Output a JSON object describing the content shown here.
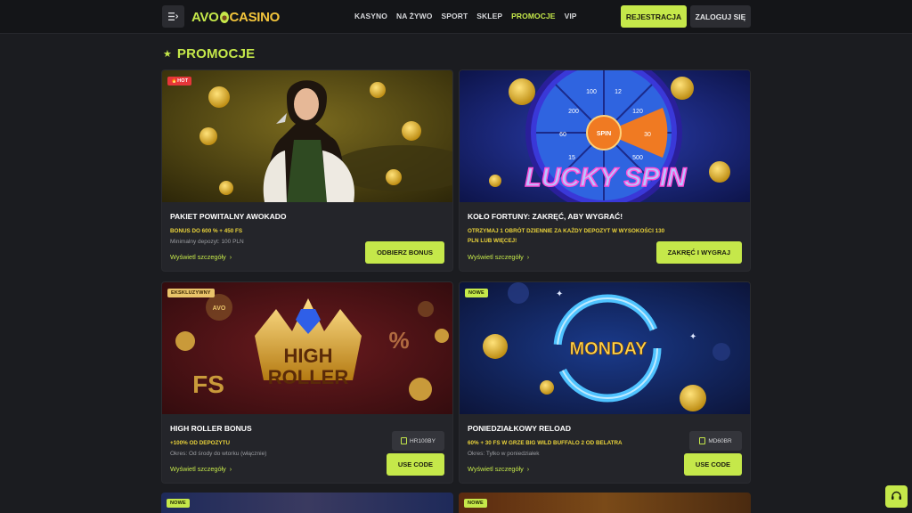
{
  "header": {
    "logo_left": "AVO",
    "logo_right": "CASINO",
    "nav": [
      "KASYNO",
      "NA ŻYWO",
      "SPORT",
      "SKLEP",
      "PROMOCJE",
      "VIP"
    ],
    "active_nav": "PROMOCJE",
    "register_label": "REJESTRACJA",
    "login_label": "ZALOGUJ SIĘ"
  },
  "page": {
    "title": "PROMOCJE"
  },
  "cards": [
    {
      "badge": "HOT",
      "title": "PAKIET POWITALNY AWOKADO",
      "subtitle": "BONUS DO 600 % + 450 FS",
      "description": "Minimalny depozyt: 100 PLN",
      "details": "Wyświetl szczegóły",
      "cta": "ODBIERZ BONUS"
    },
    {
      "badge": "",
      "title": "KOŁO FORTUNY: ZAKRĘĆ, ABY WYGRAĆ!",
      "subtitle": "OTRZYMAJ 1 OBRÓT DZIENNIE ZA KAŻDY DEPOZYT W WYSOKOŚCI 130 PLN LUB WIĘCEJ!",
      "description": "",
      "details": "Wyświetl szczegóły",
      "cta": "ZAKRĘĆ I WYGRAJ",
      "image_text": "LUCKY SPIN",
      "wheel_labels": [
        "SPIN",
        "120",
        "30",
        "500",
        "15",
        "60",
        "200",
        "100",
        "12"
      ]
    },
    {
      "badge": "EKSKLUZYWNY",
      "title": "HIGH ROLLER BONUS",
      "subtitle": "+100% OD DEPOZYTU",
      "description": "Okres: Od środy do wtorku (włącznie)",
      "details": "Wyświetl szczegóły",
      "code": "HR100BY",
      "cta": "USE CODE",
      "image_text": [
        "HIGH",
        "ROLLER"
      ],
      "image_extras": [
        "FS",
        "%",
        "AVO"
      ]
    },
    {
      "badge": "NOWE",
      "title": "PONIEDZIAŁKOWY RELOAD",
      "subtitle": "60% + 30 FS W GRZE BIG WILD BUFFALO 2 OD BELATRA",
      "description": "Okres: Tylko w poniedziałek",
      "details": "Wyświetl szczegóły",
      "code": "MD60BR",
      "cta": "USE CODE",
      "image_text": "MONDAY"
    }
  ],
  "bottom_badges": [
    "NOWE",
    "NOWE"
  ],
  "colors": {
    "accent": "#c5e84a",
    "gold": "#e9d23a",
    "background": "#1b1c20",
    "card": "#24252a"
  }
}
